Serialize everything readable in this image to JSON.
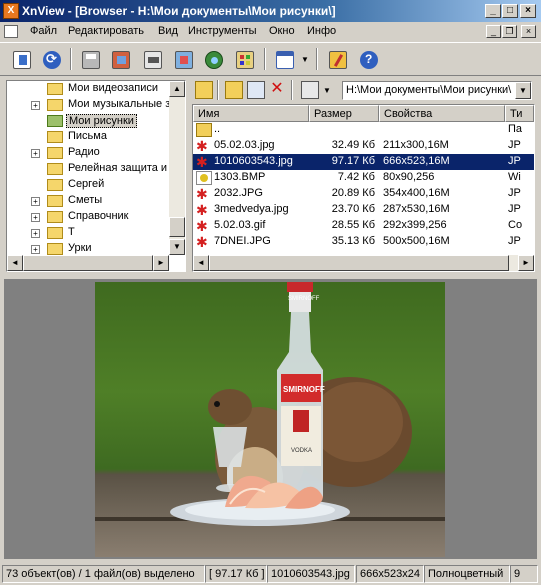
{
  "window": {
    "title": "XnView - [Browser - H:\\Мои документы\\Мои рисунки\\]",
    "app_icon": "X"
  },
  "menu": {
    "items": [
      "Файл",
      "Редактировать",
      "Вид",
      "Инструменты",
      "Окно",
      "Инфо"
    ]
  },
  "toolbar": {
    "icons": [
      "edit-icon",
      "refresh-icon",
      "print-icon",
      "slideshow-icon",
      "scan-icon",
      "convert-icon",
      "web-icon",
      "browser-icon",
      "layout-icon",
      "settings-icon",
      "help-icon"
    ]
  },
  "tree": {
    "items": [
      {
        "label": "Мои видеозаписи",
        "expandable": false,
        "selected": false
      },
      {
        "label": "Мои музыкальные за",
        "expandable": true,
        "selected": false
      },
      {
        "label": "Мои рисунки",
        "expandable": false,
        "selected": true
      },
      {
        "label": "Письма",
        "expandable": false,
        "selected": false
      },
      {
        "label": "Радио",
        "expandable": true,
        "selected": false
      },
      {
        "label": "Релейная защита и",
        "expandable": false,
        "selected": false
      },
      {
        "label": "Сергей",
        "expandable": false,
        "selected": false
      },
      {
        "label": "Сметы",
        "expandable": true,
        "selected": false
      },
      {
        "label": "Справочник",
        "expandable": true,
        "selected": false
      },
      {
        "label": "Т",
        "expandable": true,
        "selected": false
      },
      {
        "label": "Урки",
        "expandable": true,
        "selected": false
      }
    ]
  },
  "path": "H:\\Мои документы\\Мои рисунки\\",
  "filelist": {
    "columns": [
      "Имя",
      "Размер",
      "Свойства",
      "Ти"
    ],
    "rows": [
      {
        "name": "..",
        "size": "",
        "props": "",
        "type": "Па",
        "icon": "folder"
      },
      {
        "name": "05.02.03.jpg",
        "size": "32.49 Кб",
        "props": "211x300,16M",
        "type": "JP",
        "icon": "jpg"
      },
      {
        "name": "1010603543.jpg",
        "size": "97.17 Кб",
        "props": "666x523,16M",
        "type": "JP",
        "icon": "jpg",
        "selected": true
      },
      {
        "name": "1303.BMP",
        "size": "7.42 Кб",
        "props": "80x90,256",
        "type": "Wi",
        "icon": "bmp"
      },
      {
        "name": "2032.JPG",
        "size": "20.89 Кб",
        "props": "354x400,16M",
        "type": "JP",
        "icon": "jpg"
      },
      {
        "name": "3medvedya.jpg",
        "size": "23.70 Кб",
        "props": "287x530,16M",
        "type": "JP",
        "icon": "jpg"
      },
      {
        "name": "5.02.03.gif",
        "size": "28.55 Кб",
        "props": "292x399,256",
        "type": "Co",
        "icon": "gif"
      },
      {
        "name": "7DNEI.JPG",
        "size": "35.13 Кб",
        "props": "500x500,16M",
        "type": "JP",
        "icon": "jpg"
      }
    ]
  },
  "preview": {
    "bottle_label_top": "SMIRNOFF",
    "bottle_brand": "SMIRNOFF",
    "bottle_label_bottom": "VODKA"
  },
  "status": {
    "objects": "73 объект(ов) / 1 файл(ов) выделено",
    "size": "[ 97.17 Кб ]",
    "filename": "1010603543.jpg",
    "dims": "666x523x24",
    "mode": "Полноцветный",
    "extra": "9"
  }
}
